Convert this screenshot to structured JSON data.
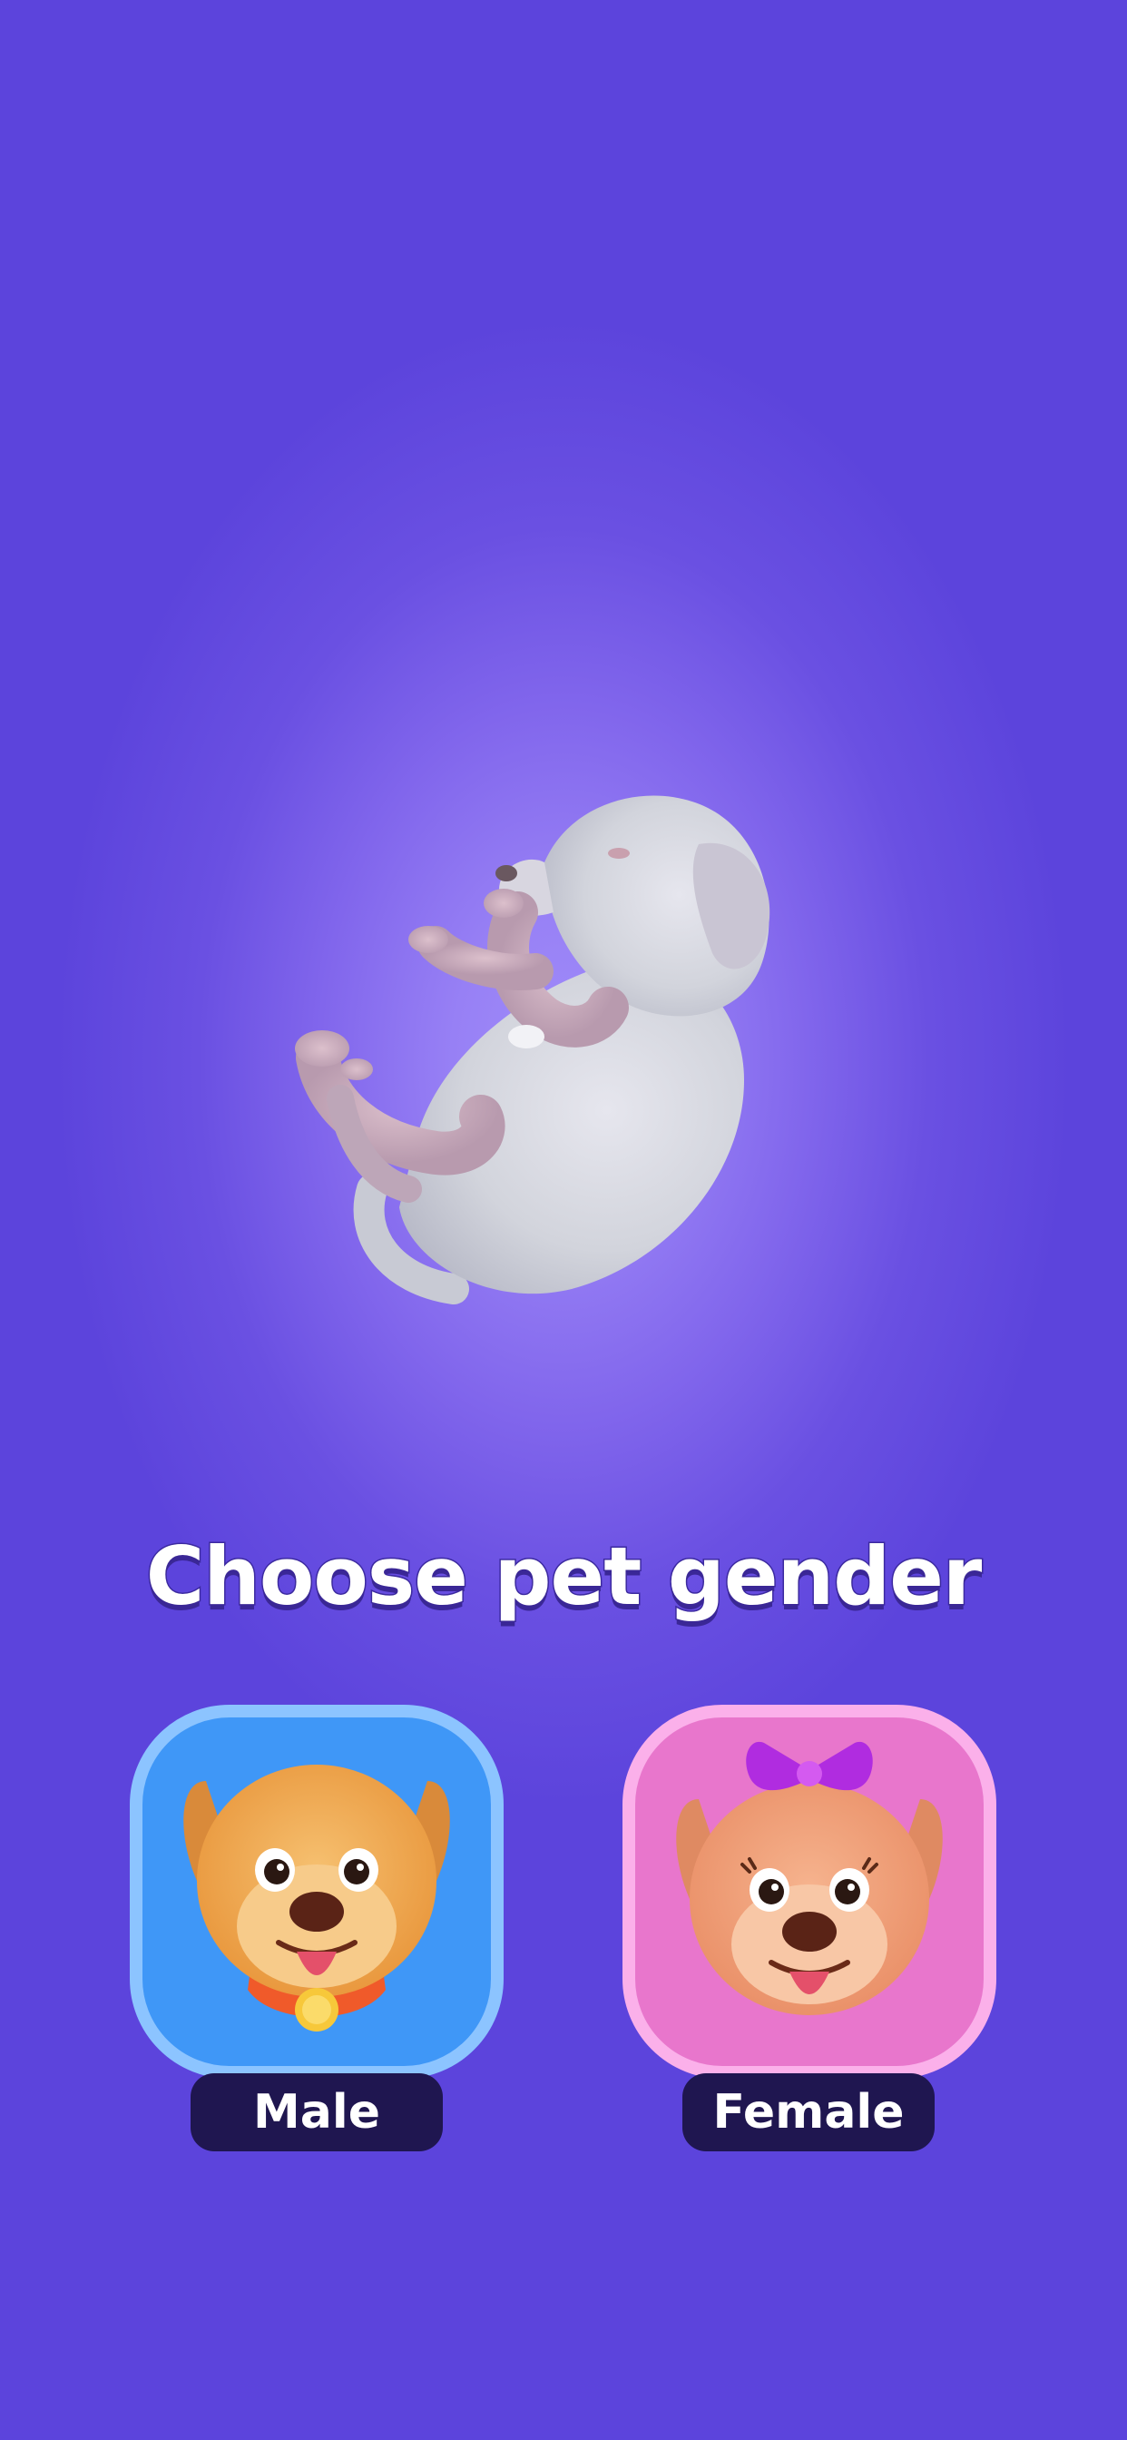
{
  "screen": {
    "title": "Choose pet gender",
    "background_color": "#5c44dc",
    "glow_color": "#a08cfa"
  },
  "preview": {
    "icon": "puppy-3d-model"
  },
  "options": [
    {
      "label": "Male",
      "icon": "male-dog-face-icon",
      "card_color": "#3f97f7",
      "border_color": "#8cc4ff"
    },
    {
      "label": "Female",
      "icon": "female-dog-face-with-bow-icon",
      "card_color": "#e876cc",
      "border_color": "#fbb0ea"
    }
  ],
  "label_color": "#1f1650"
}
